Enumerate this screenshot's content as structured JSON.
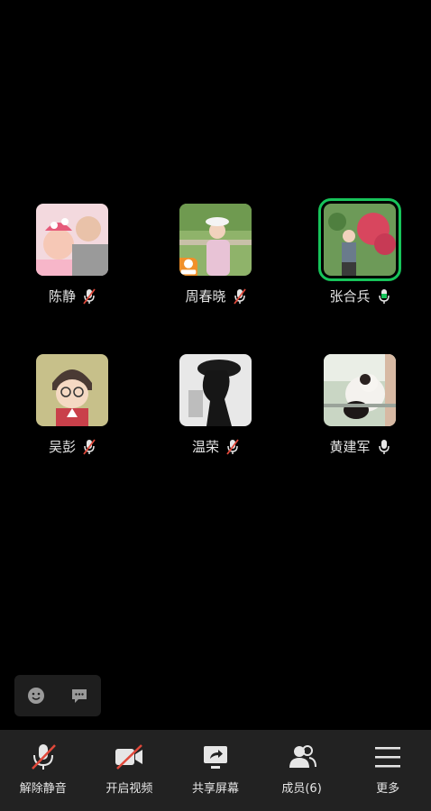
{
  "participants": [
    {
      "name": "陈静",
      "muted": true,
      "host": false,
      "speaking": false,
      "avatar": "girl-with-baby"
    },
    {
      "name": "周春晓",
      "muted": true,
      "host": true,
      "speaking": false,
      "avatar": "woman-in-hat"
    },
    {
      "name": "张合兵",
      "muted": false,
      "host": false,
      "speaking": true,
      "avatar": "man-with-flowers"
    },
    {
      "name": "吴彭",
      "muted": true,
      "host": false,
      "speaking": false,
      "avatar": "cartoon-detective"
    },
    {
      "name": "温荣",
      "muted": true,
      "host": false,
      "speaking": false,
      "avatar": "black-white-photo"
    },
    {
      "name": "黄建军",
      "muted": false,
      "host": false,
      "speaking": false,
      "avatar": "cat-photo"
    }
  ],
  "toolbar": {
    "unmute_label": "解除静音",
    "video_label": "开启视频",
    "share_label": "共享屏幕",
    "members_label": "成员(6)",
    "more_label": "更多"
  },
  "colors": {
    "speaking": "#17c45a",
    "host_badge": "#f0902a",
    "mute_slash": "#e0483a",
    "bar": "#222222"
  }
}
